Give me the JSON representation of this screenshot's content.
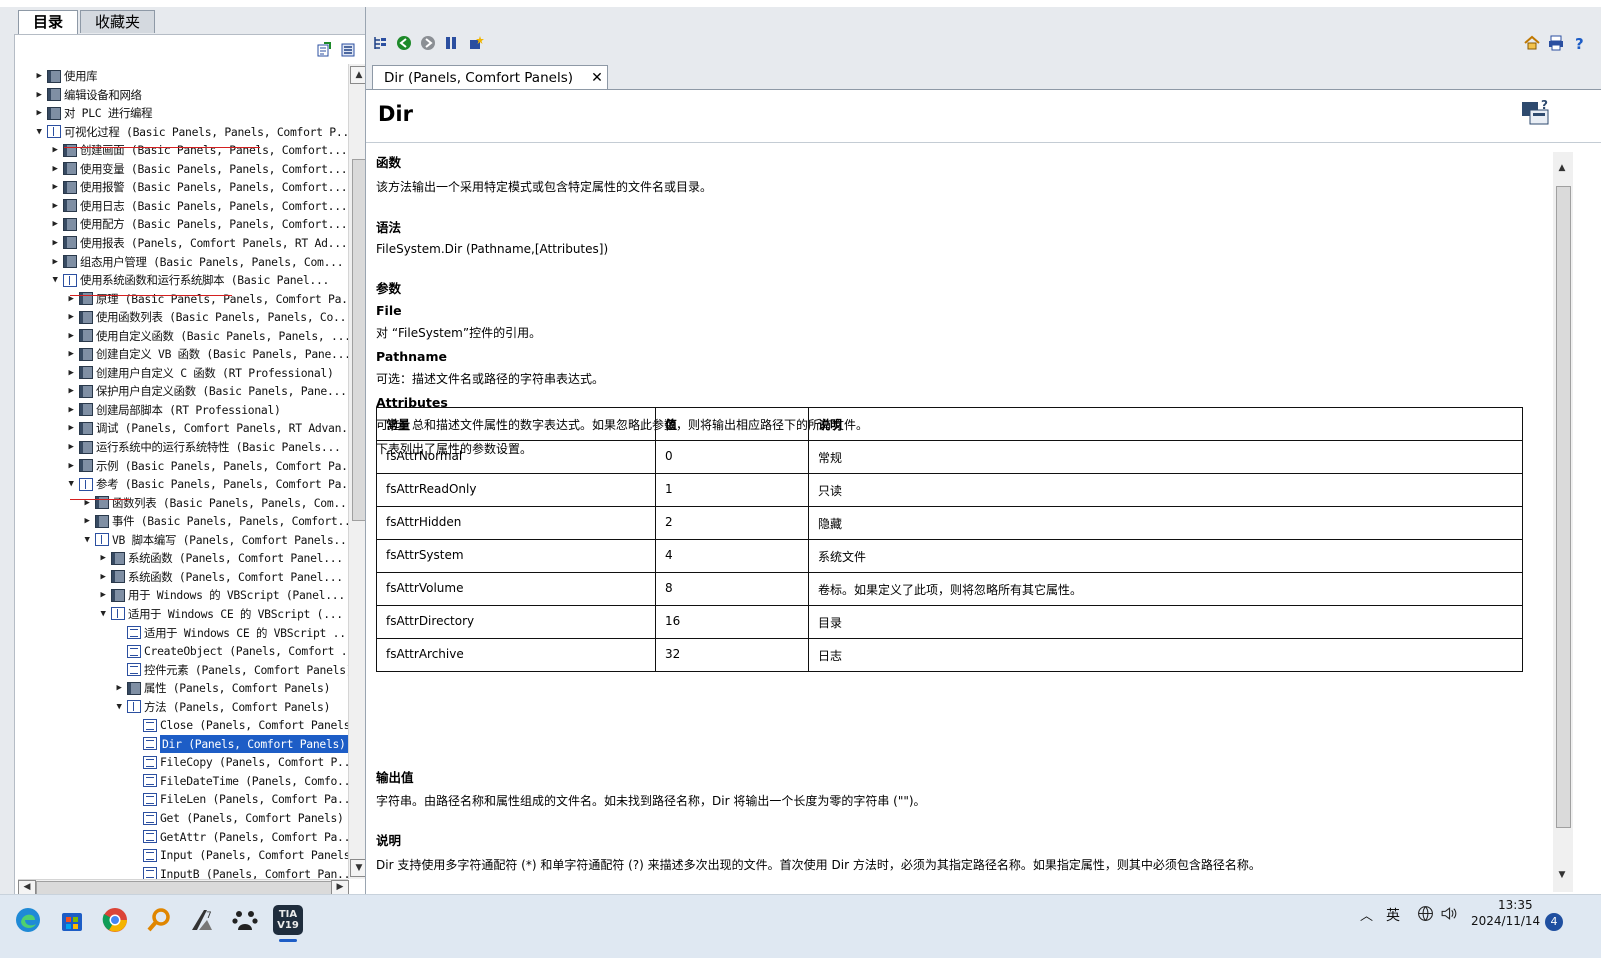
{
  "left_tabs": [
    {
      "label": "目录",
      "active": true
    },
    {
      "label": "收藏夹",
      "active": false
    }
  ],
  "tree": [
    {
      "label": "使用库",
      "level": 0,
      "toggle": "▶",
      "icon": "closed"
    },
    {
      "label": "编辑设备和网络",
      "level": 0,
      "toggle": "▶",
      "icon": "closed"
    },
    {
      "label": "对 PLC 进行编程",
      "level": 0,
      "toggle": "▶",
      "icon": "closed"
    },
    {
      "label": "可视化过程 (Basic Panels, Panels, Comfort P...",
      "level": 0,
      "toggle": "▼",
      "icon": "open"
    },
    {
      "label": "创建画面 (Basic Panels, Panels, Comfort...",
      "level": 1,
      "toggle": "▶",
      "icon": "closed"
    },
    {
      "label": "使用变量 (Basic Panels, Panels, Comfort...",
      "level": 1,
      "toggle": "▶",
      "icon": "closed"
    },
    {
      "label": "使用报警 (Basic Panels, Panels, Comfort...",
      "level": 1,
      "toggle": "▶",
      "icon": "closed"
    },
    {
      "label": "使用日志 (Basic Panels, Panels, Comfort...",
      "level": 1,
      "toggle": "▶",
      "icon": "closed"
    },
    {
      "label": "使用配方 (Basic Panels, Panels, Comfort...",
      "level": 1,
      "toggle": "▶",
      "icon": "closed"
    },
    {
      "label": "使用报表 (Panels, Comfort Panels, RT Ad...",
      "level": 1,
      "toggle": "▶",
      "icon": "closed"
    },
    {
      "label": "组态用户管理 (Basic Panels, Panels, Com...",
      "level": 1,
      "toggle": "▶",
      "icon": "closed"
    },
    {
      "label": "使用系统函数和运行系统脚本 (Basic Panel...",
      "level": 1,
      "toggle": "▼",
      "icon": "open"
    },
    {
      "label": "原理 (Basic Panels, Panels, Comfort Pa...",
      "level": 2,
      "toggle": "▶",
      "icon": "closed"
    },
    {
      "label": "使用函数列表 (Basic Panels, Panels, Co...",
      "level": 2,
      "toggle": "▶",
      "icon": "closed"
    },
    {
      "label": "使用自定义函数 (Basic Panels, Panels, ...",
      "level": 2,
      "toggle": "▶",
      "icon": "closed"
    },
    {
      "label": "创建自定义 VB 函数 (Basic Panels, Pane...",
      "level": 2,
      "toggle": "▶",
      "icon": "closed"
    },
    {
      "label": "创建用户自定义 C 函数 (RT Professional)",
      "level": 2,
      "toggle": "▶",
      "icon": "closed"
    },
    {
      "label": "保护用户自定义函数 (Basic Panels, Pane...",
      "level": 2,
      "toggle": "▶",
      "icon": "closed"
    },
    {
      "label": "创建局部脚本 (RT Professional)",
      "level": 2,
      "toggle": "▶",
      "icon": "closed"
    },
    {
      "label": "调试 (Panels, Comfort Panels, RT Advan...",
      "level": 2,
      "toggle": "▶",
      "icon": "closed"
    },
    {
      "label": "运行系统中的运行系统特性 (Basic Panels...",
      "level": 2,
      "toggle": "▶",
      "icon": "closed"
    },
    {
      "label": "示例 (Basic Panels, Panels, Comfort Pa...",
      "level": 2,
      "toggle": "▶",
      "icon": "closed"
    },
    {
      "label": "参考 (Basic Panels, Panels, Comfort Pa...",
      "level": 2,
      "toggle": "▼",
      "icon": "open"
    },
    {
      "label": "函数列表 (Basic Panels, Panels, Com...",
      "level": 3,
      "toggle": "▶",
      "icon": "closed"
    },
    {
      "label": "事件 (Basic Panels, Panels, Comfort...",
      "level": 3,
      "toggle": "▶",
      "icon": "closed"
    },
    {
      "label": "VB 脚本编写 (Panels, Comfort Panels...",
      "level": 3,
      "toggle": "▼",
      "icon": "open"
    },
    {
      "label": "系统函数 (Panels, Comfort Panel...",
      "level": 4,
      "toggle": "▶",
      "icon": "closed"
    },
    {
      "label": "系统函数 (Panels, Comfort Panel...",
      "level": 4,
      "toggle": "▶",
      "icon": "closed"
    },
    {
      "label": "用于 Windows 的 VBScript (Panel...",
      "level": 4,
      "toggle": "▶",
      "icon": "closed"
    },
    {
      "label": "适用于 Windows CE 的 VBScript (...",
      "level": 4,
      "toggle": "▼",
      "icon": "open"
    },
    {
      "label": "适用于 Windows CE 的 VBScript ...",
      "level": 5,
      "toggle": "",
      "icon": "page"
    },
    {
      "label": "CreateObject (Panels, Comfort ...",
      "level": 5,
      "toggle": "",
      "icon": "page"
    },
    {
      "label": "控件元素 (Panels, Comfort Panels)",
      "level": 5,
      "toggle": "",
      "icon": "page"
    },
    {
      "label": "属性 (Panels, Comfort Panels)",
      "level": 5,
      "toggle": "▶",
      "icon": "closed"
    },
    {
      "label": "方法 (Panels, Comfort Panels)",
      "level": 5,
      "toggle": "▼",
      "icon": "open"
    },
    {
      "label": "Close (Panels, Comfort Panels)",
      "level": 6,
      "toggle": "",
      "icon": "page"
    },
    {
      "label": "Dir (Panels, Comfort Panels)",
      "level": 6,
      "toggle": "",
      "icon": "page",
      "selected": true
    },
    {
      "label": "FileCopy (Panels, Comfort P...",
      "level": 6,
      "toggle": "",
      "icon": "page"
    },
    {
      "label": "FileDateTime (Panels, Comfo...",
      "level": 6,
      "toggle": "",
      "icon": "page"
    },
    {
      "label": "FileLen (Panels, Comfort Pa...",
      "level": 6,
      "toggle": "",
      "icon": "page"
    },
    {
      "label": "Get (Panels, Comfort Panels)",
      "level": 6,
      "toggle": "",
      "icon": "page"
    },
    {
      "label": "GetAttr (Panels, Comfort Pa...",
      "level": 6,
      "toggle": "",
      "icon": "page"
    },
    {
      "label": "Input (Panels, Comfort Panels)",
      "level": 6,
      "toggle": "",
      "icon": "page"
    },
    {
      "label": "InputB (Panels, Comfort Pan...",
      "level": 6,
      "toggle": "",
      "icon": "page"
    }
  ],
  "doc_tab": {
    "title": "Dir (Panels, Comfort Panels)",
    "close": "✕"
  },
  "doc": {
    "title": "Dir",
    "sec_function": "函数",
    "function_text": "该方法输出一个采用特定模式或包含特定属性的文件名或目录。",
    "sec_syntax": "语法",
    "syntax_text": "FileSystem.Dir (Pathname,[Attributes])",
    "sec_params": "参数",
    "param_file": "File",
    "param_file_text": "对 “FileSystem”控件的引用。",
    "param_pathname": "Pathname",
    "param_pathname_text": "可选：描述文件名或路径的字符串表达式。",
    "param_attributes": "Attributes",
    "param_attributes_text": "可选：总和描述文件属性的数字表达式。如果忽略此参数，则将输出相应路径下的所有文件。",
    "table_intro": "下表列出了属性的参数设置。",
    "sec_return": "输出值",
    "return_text": "字符串。由路径名称和属性组成的文件名。如未找到路径名称，Dir 将输出一个长度为零的字符串 (\"\")。",
    "sec_desc": "说明",
    "desc_text": "Dir 支持使用多字符通配符 (*) 和单字符通配符 (?) 来描述多次出现的文件。首次使用 Dir 方法时，必须为其指定路径名称。如果指定属性，则其中必须包含路径名称。"
  },
  "attr_table": {
    "headers": [
      "常量",
      "值",
      "说明"
    ],
    "rows": [
      [
        "fsAttrNormal",
        "0",
        "常规"
      ],
      [
        "fsAttrReadOnly",
        "1",
        "只读"
      ],
      [
        "fsAttrHidden",
        "2",
        "隐藏"
      ],
      [
        "fsAttrSystem",
        "4",
        "系统文件"
      ],
      [
        "fsAttrVolume",
        "8",
        "卷标。如果定义了此项，则将忽略所有其它属性。"
      ],
      [
        "fsAttrDirectory",
        "16",
        "目录"
      ],
      [
        "fsAttrArchive",
        "32",
        "日志"
      ]
    ]
  },
  "taskbar": {
    "apps": [
      "edge-icon",
      "store-icon",
      "chrome-icon",
      "search-app-icon",
      "step7-icon",
      "baidu-icon",
      "tia-portal-icon"
    ],
    "tia_label": "TIA V19",
    "ime": "英",
    "clock_time": "13:35",
    "clock_date": "2024/11/14",
    "notif_count": "4"
  },
  "colors": {
    "selection": "#1d5dc6",
    "annotation_red": "#d42020",
    "pane_bg": "#e7eaee"
  }
}
